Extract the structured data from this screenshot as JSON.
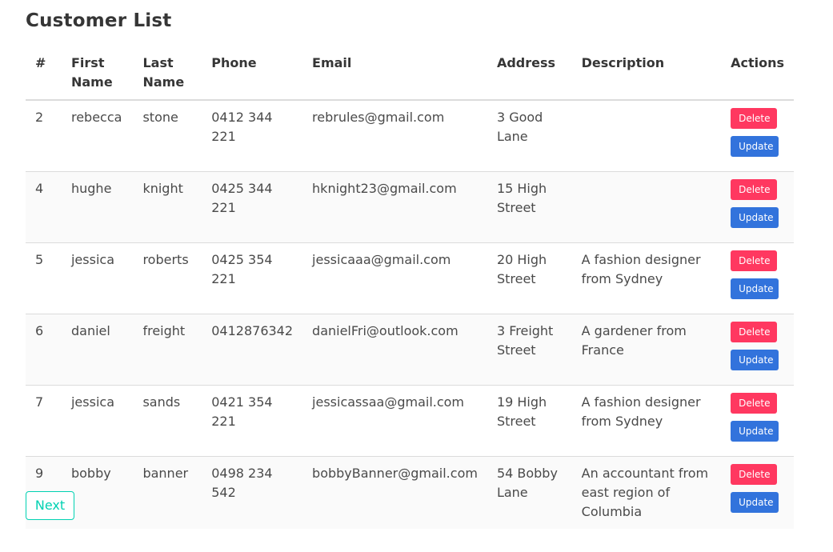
{
  "page": {
    "title": "Customer List"
  },
  "table": {
    "headers": {
      "num": "#",
      "first_name": "First Name",
      "last_name": "Last Name",
      "phone": "Phone",
      "email": "Email",
      "address": "Address",
      "description": "Description",
      "actions": "Actions"
    },
    "rows": [
      {
        "num": "2",
        "first_name": "rebecca",
        "last_name": "stone",
        "phone": "0412 344 221",
        "email": "rebrules@gmail.com",
        "address": "3 Good Lane",
        "description": "",
        "delete_label": "Delete",
        "update_label": "Update"
      },
      {
        "num": "4",
        "first_name": "hughe",
        "last_name": "knight",
        "phone": "0425 344 221",
        "email": "hknight23@gmail.com",
        "address": "15 High Street",
        "description": "",
        "delete_label": "Delete",
        "update_label": "Update"
      },
      {
        "num": "5",
        "first_name": "jessica",
        "last_name": "roberts",
        "phone": "0425 354 221",
        "email": "jessicaaa@gmail.com",
        "address": "20 High Street",
        "description": "A fashion designer from Sydney",
        "delete_label": "Delete",
        "update_label": "Update"
      },
      {
        "num": "6",
        "first_name": "daniel",
        "last_name": "freight",
        "phone": "0412876342",
        "email": "danielFri@outlook.com",
        "address": "3 Freight Street",
        "description": "A gardener from France",
        "delete_label": "Delete",
        "update_label": "Update"
      },
      {
        "num": "7",
        "first_name": "jessica",
        "last_name": "sands",
        "phone": "0421 354 221",
        "email": "jessicassaa@gmail.com",
        "address": "19 High Street",
        "description": "A fashion designer from Sydney",
        "delete_label": "Delete",
        "update_label": "Update"
      },
      {
        "num": "9",
        "first_name": "bobby",
        "last_name": "banner",
        "phone": "0498 234 542",
        "email": "bobbyBanner@gmail.com",
        "address": "54 Bobby Lane",
        "description": "An accountant from east region of Columbia",
        "delete_label": "Delete",
        "update_label": "Update"
      }
    ]
  },
  "pagination": {
    "next_label": "Next"
  },
  "colors": {
    "delete": "#ff3860",
    "update": "#3273dc",
    "next_accent": "#00d1b2",
    "text": "#363636"
  }
}
